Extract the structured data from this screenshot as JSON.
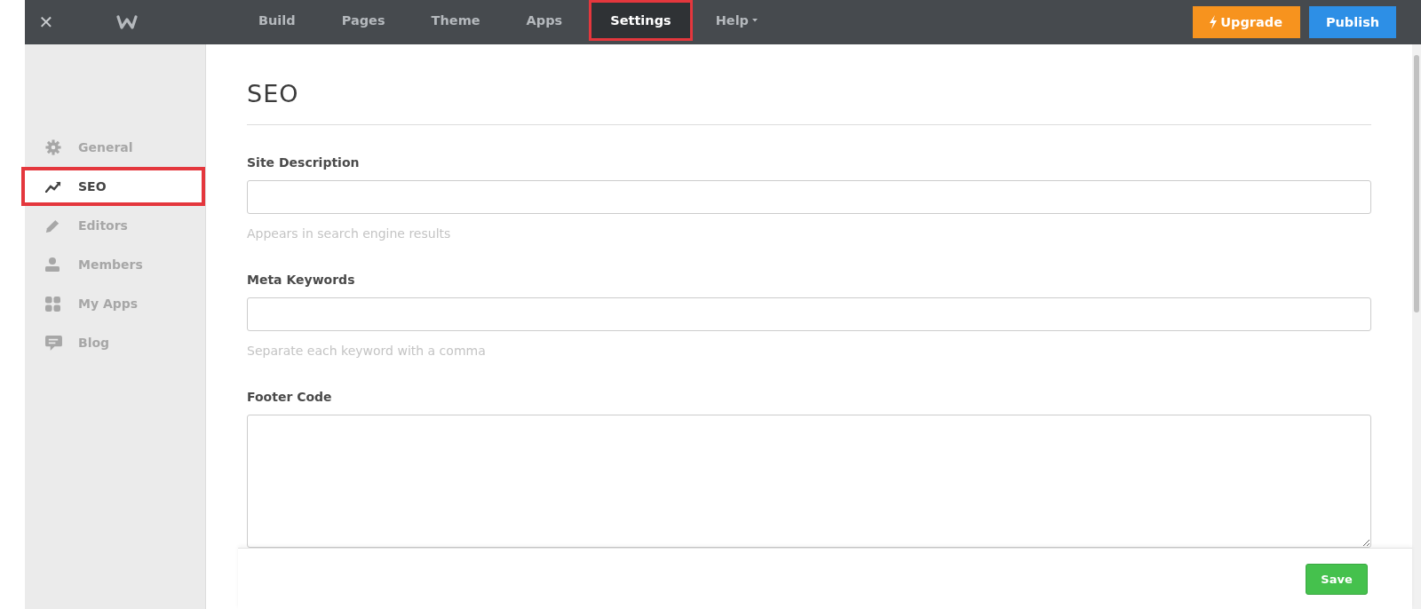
{
  "topbar": {
    "close": "✕",
    "tabs": [
      {
        "label": "Build",
        "selected": false,
        "highlighted": false,
        "dropdown": false
      },
      {
        "label": "Pages",
        "selected": false,
        "highlighted": false,
        "dropdown": false
      },
      {
        "label": "Theme",
        "selected": false,
        "highlighted": false,
        "dropdown": false
      },
      {
        "label": "Apps",
        "selected": false,
        "highlighted": false,
        "dropdown": false
      },
      {
        "label": "Settings",
        "selected": true,
        "highlighted": true,
        "dropdown": false
      },
      {
        "label": "Help",
        "selected": false,
        "highlighted": false,
        "dropdown": true
      }
    ],
    "upgrade": "Upgrade",
    "publish": "Publish"
  },
  "sidebar": {
    "items": [
      {
        "label": "General",
        "kind": "gear",
        "selected": false,
        "highlighted": false
      },
      {
        "label": "SEO",
        "kind": "trend",
        "selected": true,
        "highlighted": true
      },
      {
        "label": "Editors",
        "kind": "pencil",
        "selected": false,
        "highlighted": false
      },
      {
        "label": "Members",
        "kind": "person",
        "selected": false,
        "highlighted": false
      },
      {
        "label": "My Apps",
        "kind": "grid",
        "selected": false,
        "highlighted": false
      },
      {
        "label": "Blog",
        "kind": "comment",
        "selected": false,
        "highlighted": false
      }
    ]
  },
  "page": {
    "title": "SEO",
    "fields": [
      {
        "label": "Site Description",
        "kind": "input",
        "hint": "Appears in search engine results"
      },
      {
        "label": "Meta Keywords",
        "kind": "input",
        "hint": "Separate each keyword with a comma"
      },
      {
        "label": "Footer Code",
        "kind": "textarea"
      }
    ]
  },
  "footer": {
    "save": "Save"
  }
}
